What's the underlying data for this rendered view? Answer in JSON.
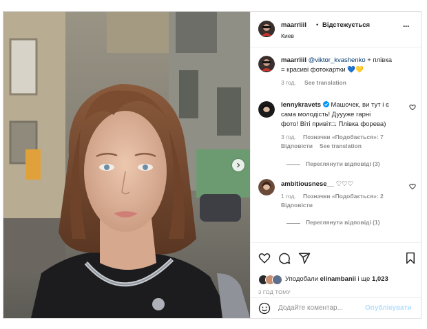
{
  "post": {
    "username": "maarriiil",
    "follow_label": "Відстежується",
    "separator": "•",
    "location": "Киев",
    "more_label": "···"
  },
  "caption": {
    "username": "maarriiil",
    "mention": "@viktor_kvashenko",
    "text_line1_rest": " + плівка",
    "text_line2": "= красиві фотокартки 💙💛",
    "time": "3 год.",
    "see_translation": "See translation"
  },
  "comments": [
    {
      "username": "lennykravets",
      "text_line1_rest": " Машочек, ви тут і є",
      "text_line2": "сама молодість! Дуууже гарні",
      "text_line3": "фото! Віті привіт□. Плівка форева)",
      "time": "3 год.",
      "likes": "Позначки «Подобається»: 7",
      "reply": "Відповісти",
      "see_translation": "See translation",
      "view_replies": "Переглянути відповіді (3)"
    },
    {
      "username": "ambitiousnese__",
      "text_rest": " ♡♡♡",
      "time": "1 год.",
      "likes": "Позначки «Подобається»: 2",
      "reply": "Відповісти",
      "view_replies": "Переглянути відповіді (1)"
    }
  ],
  "likes": {
    "prefix": "Уподобали ",
    "user": "elinambanii",
    "middle": " і ще ",
    "count": "1,023"
  },
  "timestamp": "3 ГОД ТОМУ",
  "comment_box": {
    "placeholder": "Додайте коментар...",
    "publish": "Опублікувати"
  },
  "colors": {
    "verified": "#0095f6",
    "publish_disabled": "#b2dffc",
    "link": "#00376b"
  }
}
